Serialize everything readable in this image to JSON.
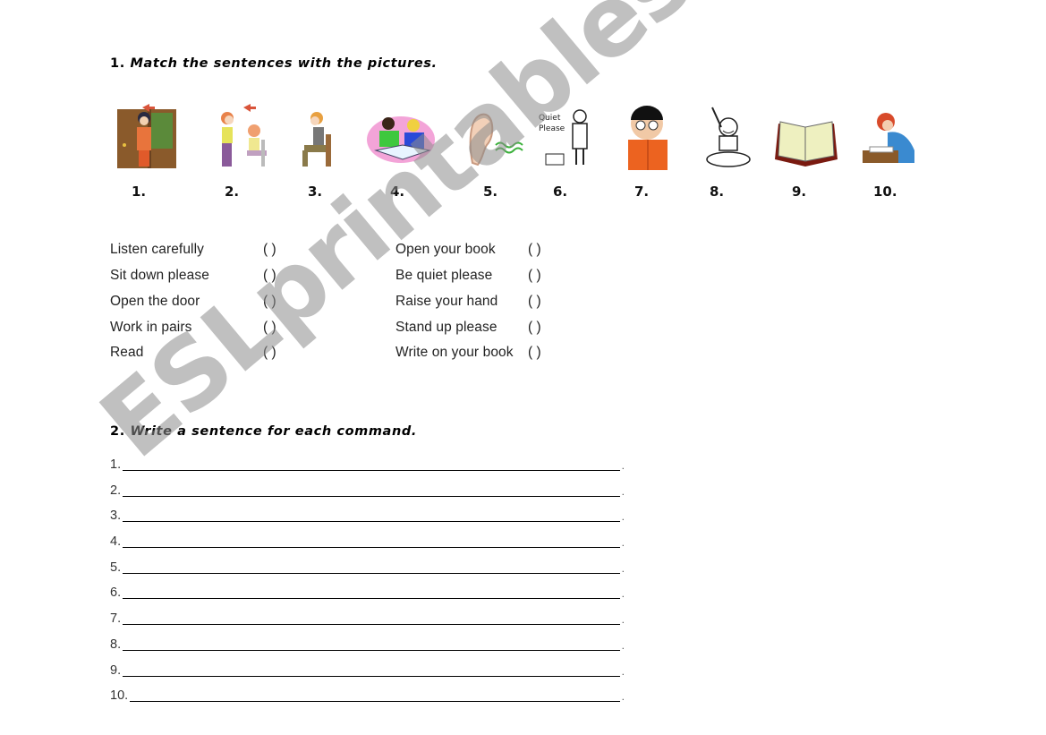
{
  "section1": {
    "number": "1.",
    "title": "Match the sentences with the pictures.",
    "pictures": [
      {
        "label": "1.",
        "icon": "open-door-icon"
      },
      {
        "label": "2.",
        "icon": "stand-up-icon"
      },
      {
        "label": "3.",
        "icon": "sit-down-icon"
      },
      {
        "label": "4.",
        "icon": "work-in-pairs-icon"
      },
      {
        "label": "5.",
        "icon": "ear-listen-icon"
      },
      {
        "label": "6.",
        "icon": "quiet-please-icon"
      },
      {
        "label": "7.",
        "icon": "boy-reading-icon"
      },
      {
        "label": "8.",
        "icon": "raise-hand-icon"
      },
      {
        "label": "9.",
        "icon": "open-book-icon"
      },
      {
        "label": "10.",
        "icon": "writing-icon"
      }
    ],
    "left_column": [
      {
        "text": "Listen carefully",
        "answer": "(  )"
      },
      {
        "text": "Sit down please",
        "answer": "(  )"
      },
      {
        "text": "Open the door",
        "answer": "(  )"
      },
      {
        "text": "Work in pairs",
        "answer": "(  )"
      },
      {
        "text": "Read",
        "answer": "(  )"
      }
    ],
    "right_column": [
      {
        "text": "Open your book",
        "answer": "(  )"
      },
      {
        "text": "Be quiet please",
        "answer": "(  )"
      },
      {
        "text": "Raise your hand",
        "answer": "(  )"
      },
      {
        "text": "Stand up please",
        "answer": "(  )"
      },
      {
        "text": "Write on your book",
        "answer": "(  )"
      }
    ]
  },
  "section2": {
    "number": "2.",
    "title": "Write a sentence for each command.",
    "lines": [
      "1.",
      "2.",
      "3.",
      "4.",
      "5.",
      "6.",
      "7.",
      "8.",
      "9.",
      "10."
    ],
    "line_end": "."
  },
  "watermark": "ESLprintables.com"
}
